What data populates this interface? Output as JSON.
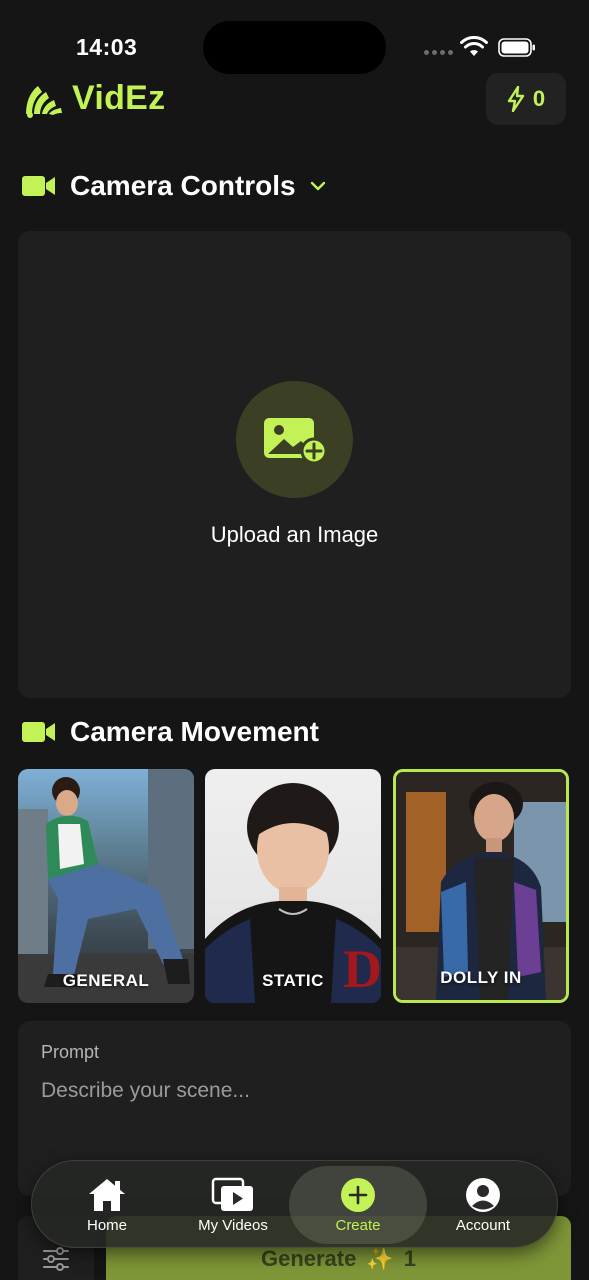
{
  "status_bar": {
    "time": "14:03"
  },
  "header": {
    "app_name": "VidEz",
    "credits": "0"
  },
  "camera_controls": {
    "title": "Camera Controls"
  },
  "upload": {
    "label": "Upload an Image"
  },
  "camera_movement": {
    "title": "Camera Movement",
    "options": [
      {
        "label": "GENERAL",
        "selected": false
      },
      {
        "label": "STATIC",
        "selected": false
      },
      {
        "label": "DOLLY IN",
        "selected": true
      }
    ]
  },
  "prompt": {
    "label": "Prompt",
    "placeholder": "Describe your scene..."
  },
  "generate": {
    "label": "Generate",
    "cost": "1"
  },
  "tabs": [
    {
      "label": "Home",
      "icon": "home-icon"
    },
    {
      "label": "My Videos",
      "icon": "videos-icon"
    },
    {
      "label": "Create",
      "icon": "plus-circle-icon",
      "active": true
    },
    {
      "label": "Account",
      "icon": "account-icon"
    }
  ],
  "colors": {
    "accent": "#c2f256",
    "background": "#151515",
    "panel": "#1f1f1f"
  }
}
